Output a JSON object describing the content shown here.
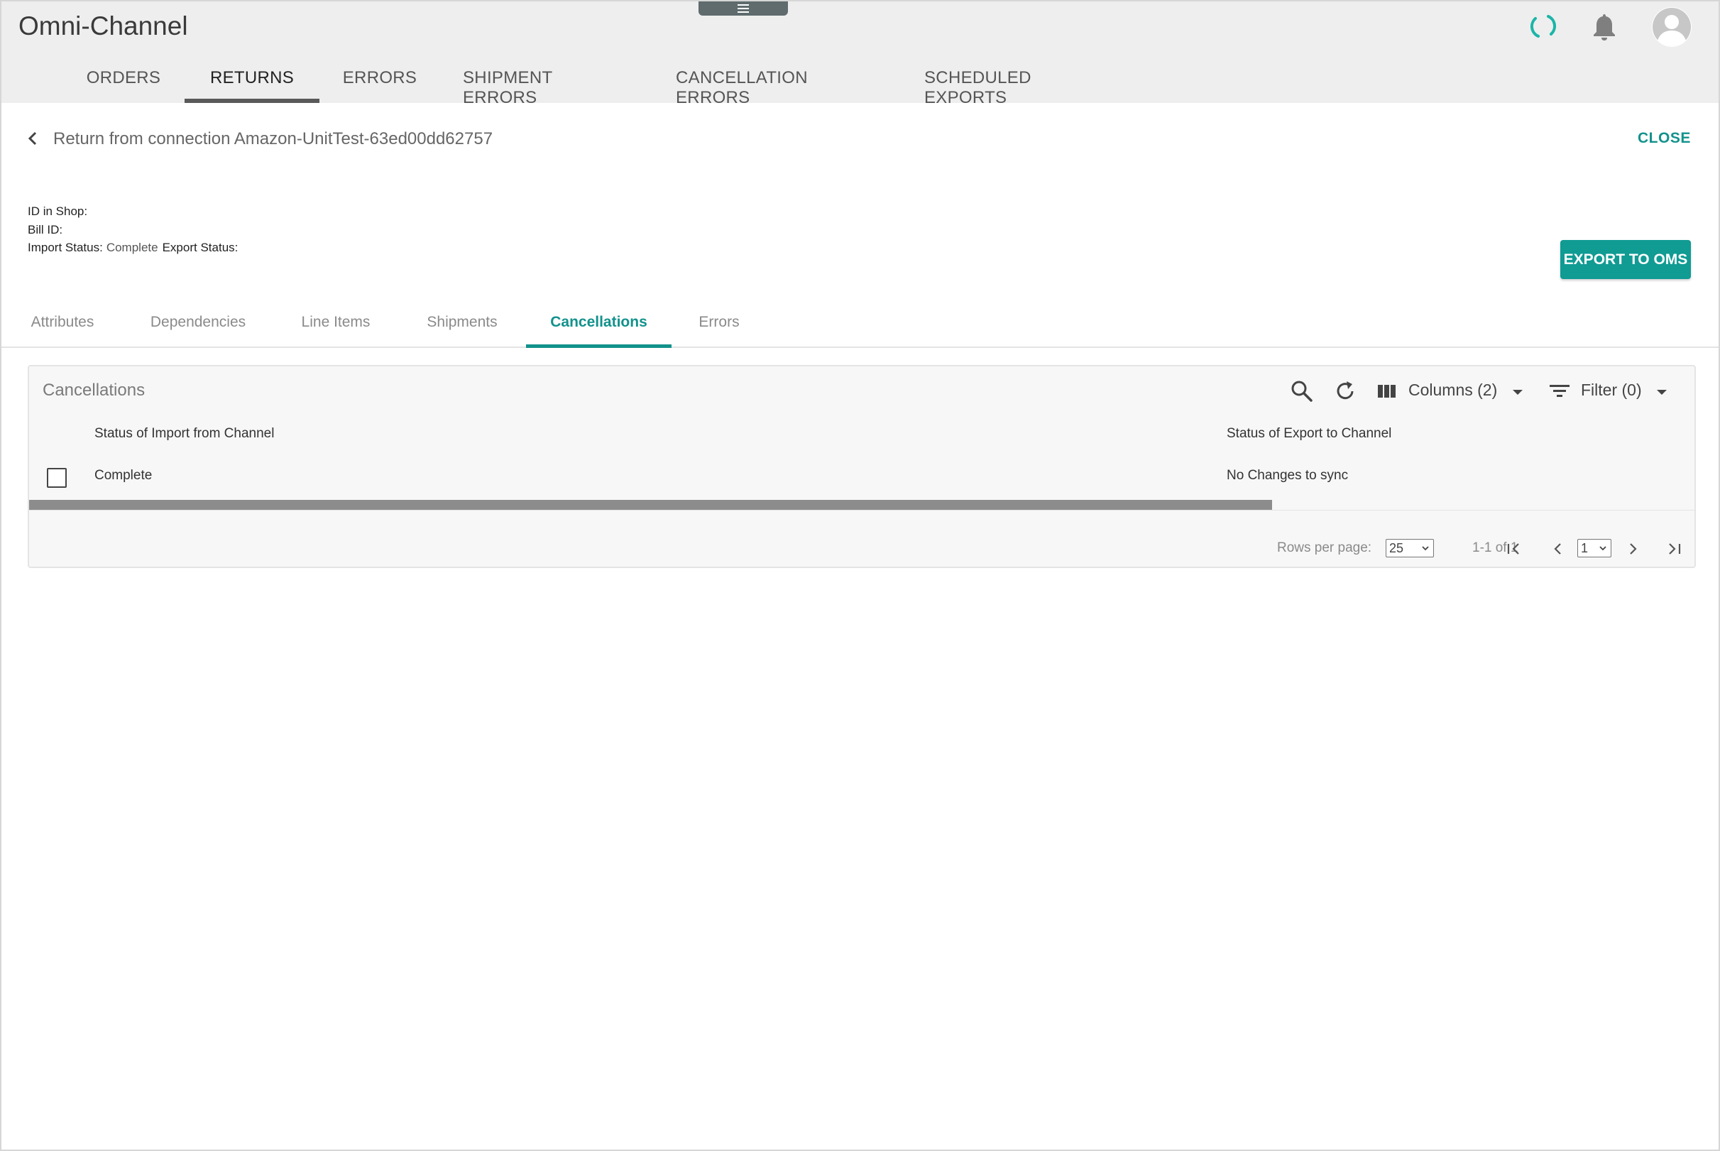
{
  "app": {
    "title": "Omni-Channel"
  },
  "main_tabs": [
    {
      "label": "ORDERS",
      "active": false
    },
    {
      "label": "RETURNS",
      "active": true
    },
    {
      "label": "ERRORS",
      "active": false
    },
    {
      "label": "SHIPMENT ERRORS",
      "active": false
    },
    {
      "label": "CANCELLATION ERRORS",
      "active": false
    },
    {
      "label": "SCHEDULED EXPORTS",
      "active": false
    }
  ],
  "detail": {
    "title": "Return from connection Amazon-UnitTest-63ed00dd62757",
    "close_label": "CLOSE",
    "id_in_shop_label": "ID in Shop:",
    "bill_id_label": "Bill ID:",
    "import_status_label": "Import Status:",
    "import_status_value": "Complete",
    "export_status_label": "Export Status:",
    "export_button_label": "EXPORT TO OMS"
  },
  "detail_tabs": [
    {
      "label": "Attributes",
      "active": false
    },
    {
      "label": "Dependencies",
      "active": false
    },
    {
      "label": "Line Items",
      "active": false
    },
    {
      "label": "Shipments",
      "active": false
    },
    {
      "label": "Cancellations",
      "active": true
    },
    {
      "label": "Errors",
      "active": false
    }
  ],
  "cancellations": {
    "title": "Cancellations",
    "columns_label": "Columns (2)",
    "filter_label": "Filter (0)",
    "headers": [
      "Status of Import from Channel",
      "Status of Export to Channel"
    ],
    "rows": [
      {
        "import_status": "Complete",
        "export_status": "No Changes to sync",
        "selected": false
      }
    ],
    "pager": {
      "rows_per_page_label": "Rows per page:",
      "rows_per_page_value": "25",
      "range_text": "1-1 of 1",
      "page_value": "1"
    }
  },
  "colors": {
    "accent": "#12928c",
    "header_bg": "#eeeeee",
    "button_bg": "#109b93"
  },
  "icons": [
    "menu-icon",
    "loading-icon",
    "bell-icon",
    "user-avatar-icon",
    "chevron-left-icon",
    "search-icon",
    "refresh-icon",
    "columns-icon",
    "filter-icon",
    "dropdown-arrow-icon",
    "first-page-icon",
    "previous-page-icon",
    "next-page-icon",
    "last-page-icon"
  ]
}
